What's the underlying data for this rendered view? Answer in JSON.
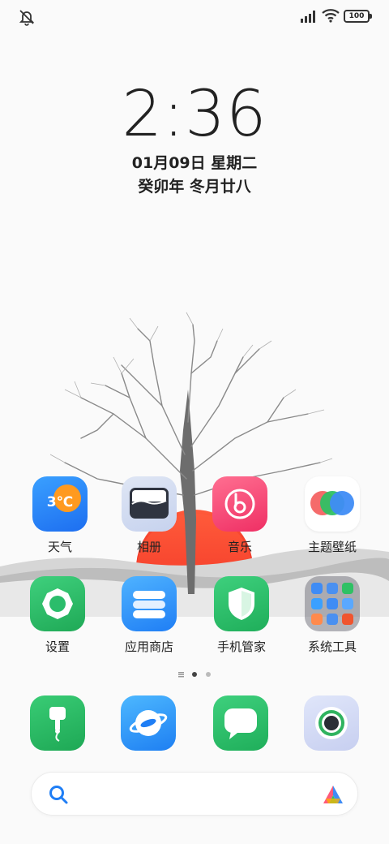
{
  "status_bar": {
    "battery": "100",
    "icons": [
      "silent-mode-icon",
      "signal-icon",
      "wifi-icon",
      "battery-icon"
    ]
  },
  "lockclock": {
    "time": "2:36",
    "date": "01月09日 星期二",
    "lunar": "癸卯年 冬月廿八"
  },
  "home": {
    "row1": [
      {
        "label": "天气",
        "icon": "weather-icon",
        "icon_text": "3℃"
      },
      {
        "label": "相册",
        "icon": "gallery-icon"
      },
      {
        "label": "音乐",
        "icon": "music-icon"
      },
      {
        "label": "主题壁纸",
        "icon": "theme-icon"
      }
    ],
    "row2": [
      {
        "label": "设置",
        "icon": "settings-icon"
      },
      {
        "label": "应用商店",
        "icon": "app-store-icon"
      },
      {
        "label": "手机管家",
        "icon": "security-icon"
      },
      {
        "label": "系统工具",
        "icon": "folder-icon"
      }
    ],
    "dock": [
      {
        "icon": "phone-icon"
      },
      {
        "icon": "browser-icon"
      },
      {
        "icon": "message-icon"
      },
      {
        "icon": "camera-icon"
      }
    ],
    "page_indicator": {
      "pages": 2,
      "current": 1
    }
  },
  "colors": {
    "accent_blue": "#1f7ef5",
    "accent_green": "#1fae5a",
    "sun_red": "#f0402a"
  }
}
